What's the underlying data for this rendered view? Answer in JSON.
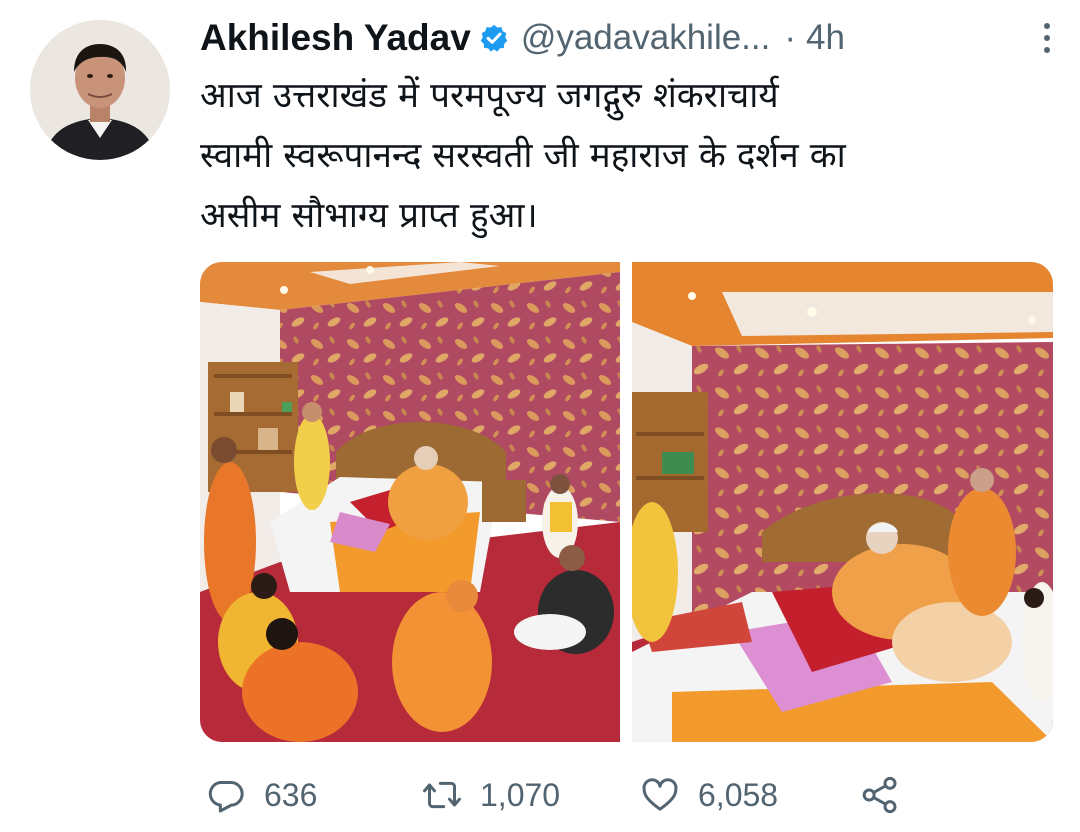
{
  "tweet": {
    "display_name": "Akhilesh Yadav",
    "handle": "@yadavakhile...",
    "separator": "·",
    "time": "4h",
    "text_lines": [
      "आज उत्तराखंड में परमपूज्य जगद्गुरु शंकराचार्य",
      "स्वामी स्वरूपानन्द सरस्वती जी महाराज के दर्शन का",
      "असीम सौभाग्य प्राप्त हुआ।"
    ],
    "verified": true
  },
  "actions": {
    "replies": "636",
    "retweets": "1,070",
    "likes": "6,058"
  },
  "icons": {
    "verified": "verified-badge-icon",
    "more": "more-vertical-icon",
    "reply": "reply-icon",
    "retweet": "retweet-icon",
    "like": "heart-icon",
    "share": "share-icon"
  },
  "colors": {
    "verified_blue": "#1d9bf0",
    "secondary_text": "#536471",
    "primary_text": "#0f1419"
  }
}
